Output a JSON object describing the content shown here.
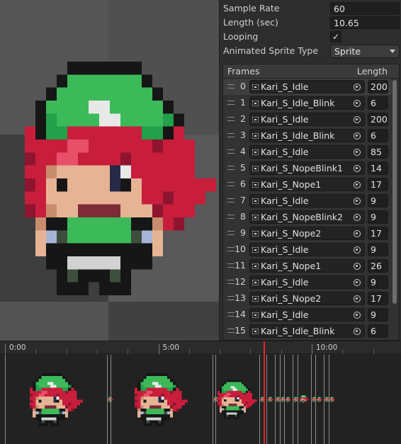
{
  "inspector": {
    "sample_rate_label": "Sample Rate",
    "sample_rate_value": "60",
    "length_label": "Length (sec)",
    "length_value": "10.65",
    "looping_label": "Looping",
    "looping_checked": "✓",
    "sprite_type_label": "Animated Sprite Type",
    "sprite_type_value": "Sprite"
  },
  "frames": {
    "header_frames": "Frames",
    "header_length": "Length",
    "rows": [
      {
        "index": "0",
        "name": "Kari_S_Idle",
        "length": "200"
      },
      {
        "index": "1",
        "name": "Kari_S_Idle_Blink",
        "length": "6"
      },
      {
        "index": "2",
        "name": "Kari_S_Idle",
        "length": "200"
      },
      {
        "index": "3",
        "name": "Kari_S_Idle_Blink",
        "length": "6"
      },
      {
        "index": "4",
        "name": "Kari_S_Idle",
        "length": "85"
      },
      {
        "index": "5",
        "name": "Kari_S_NopeBlink1",
        "length": "14"
      },
      {
        "index": "6",
        "name": "Kari_S_Nope1",
        "length": "17"
      },
      {
        "index": "7",
        "name": "Kari_S_Idle",
        "length": "9"
      },
      {
        "index": "8",
        "name": "Kari_S_NopeBlink2",
        "length": "9"
      },
      {
        "index": "9",
        "name": "Kari_S_Nope2",
        "length": "17"
      },
      {
        "index": "10",
        "name": "Kari_S_Idle",
        "length": "9"
      },
      {
        "index": "11",
        "name": "Kari_S_Nope1",
        "length": "26"
      },
      {
        "index": "12",
        "name": "Kari_S_Idle",
        "length": "9"
      },
      {
        "index": "13",
        "name": "Kari_S_Nope2",
        "length": "17"
      },
      {
        "index": "14",
        "name": "Kari_S_Idle",
        "length": "9"
      },
      {
        "index": "15",
        "name": "Kari_S_Idle_Blink",
        "length": "6"
      }
    ]
  },
  "timeline": {
    "labels": [
      "0:00",
      "5:00",
      "10:00"
    ],
    "playhead_time": "9:13"
  },
  "colors": {
    "accent_red": "#e8242c",
    "hat_green": "#3cba5a",
    "hair_red": "#c81e3c"
  }
}
